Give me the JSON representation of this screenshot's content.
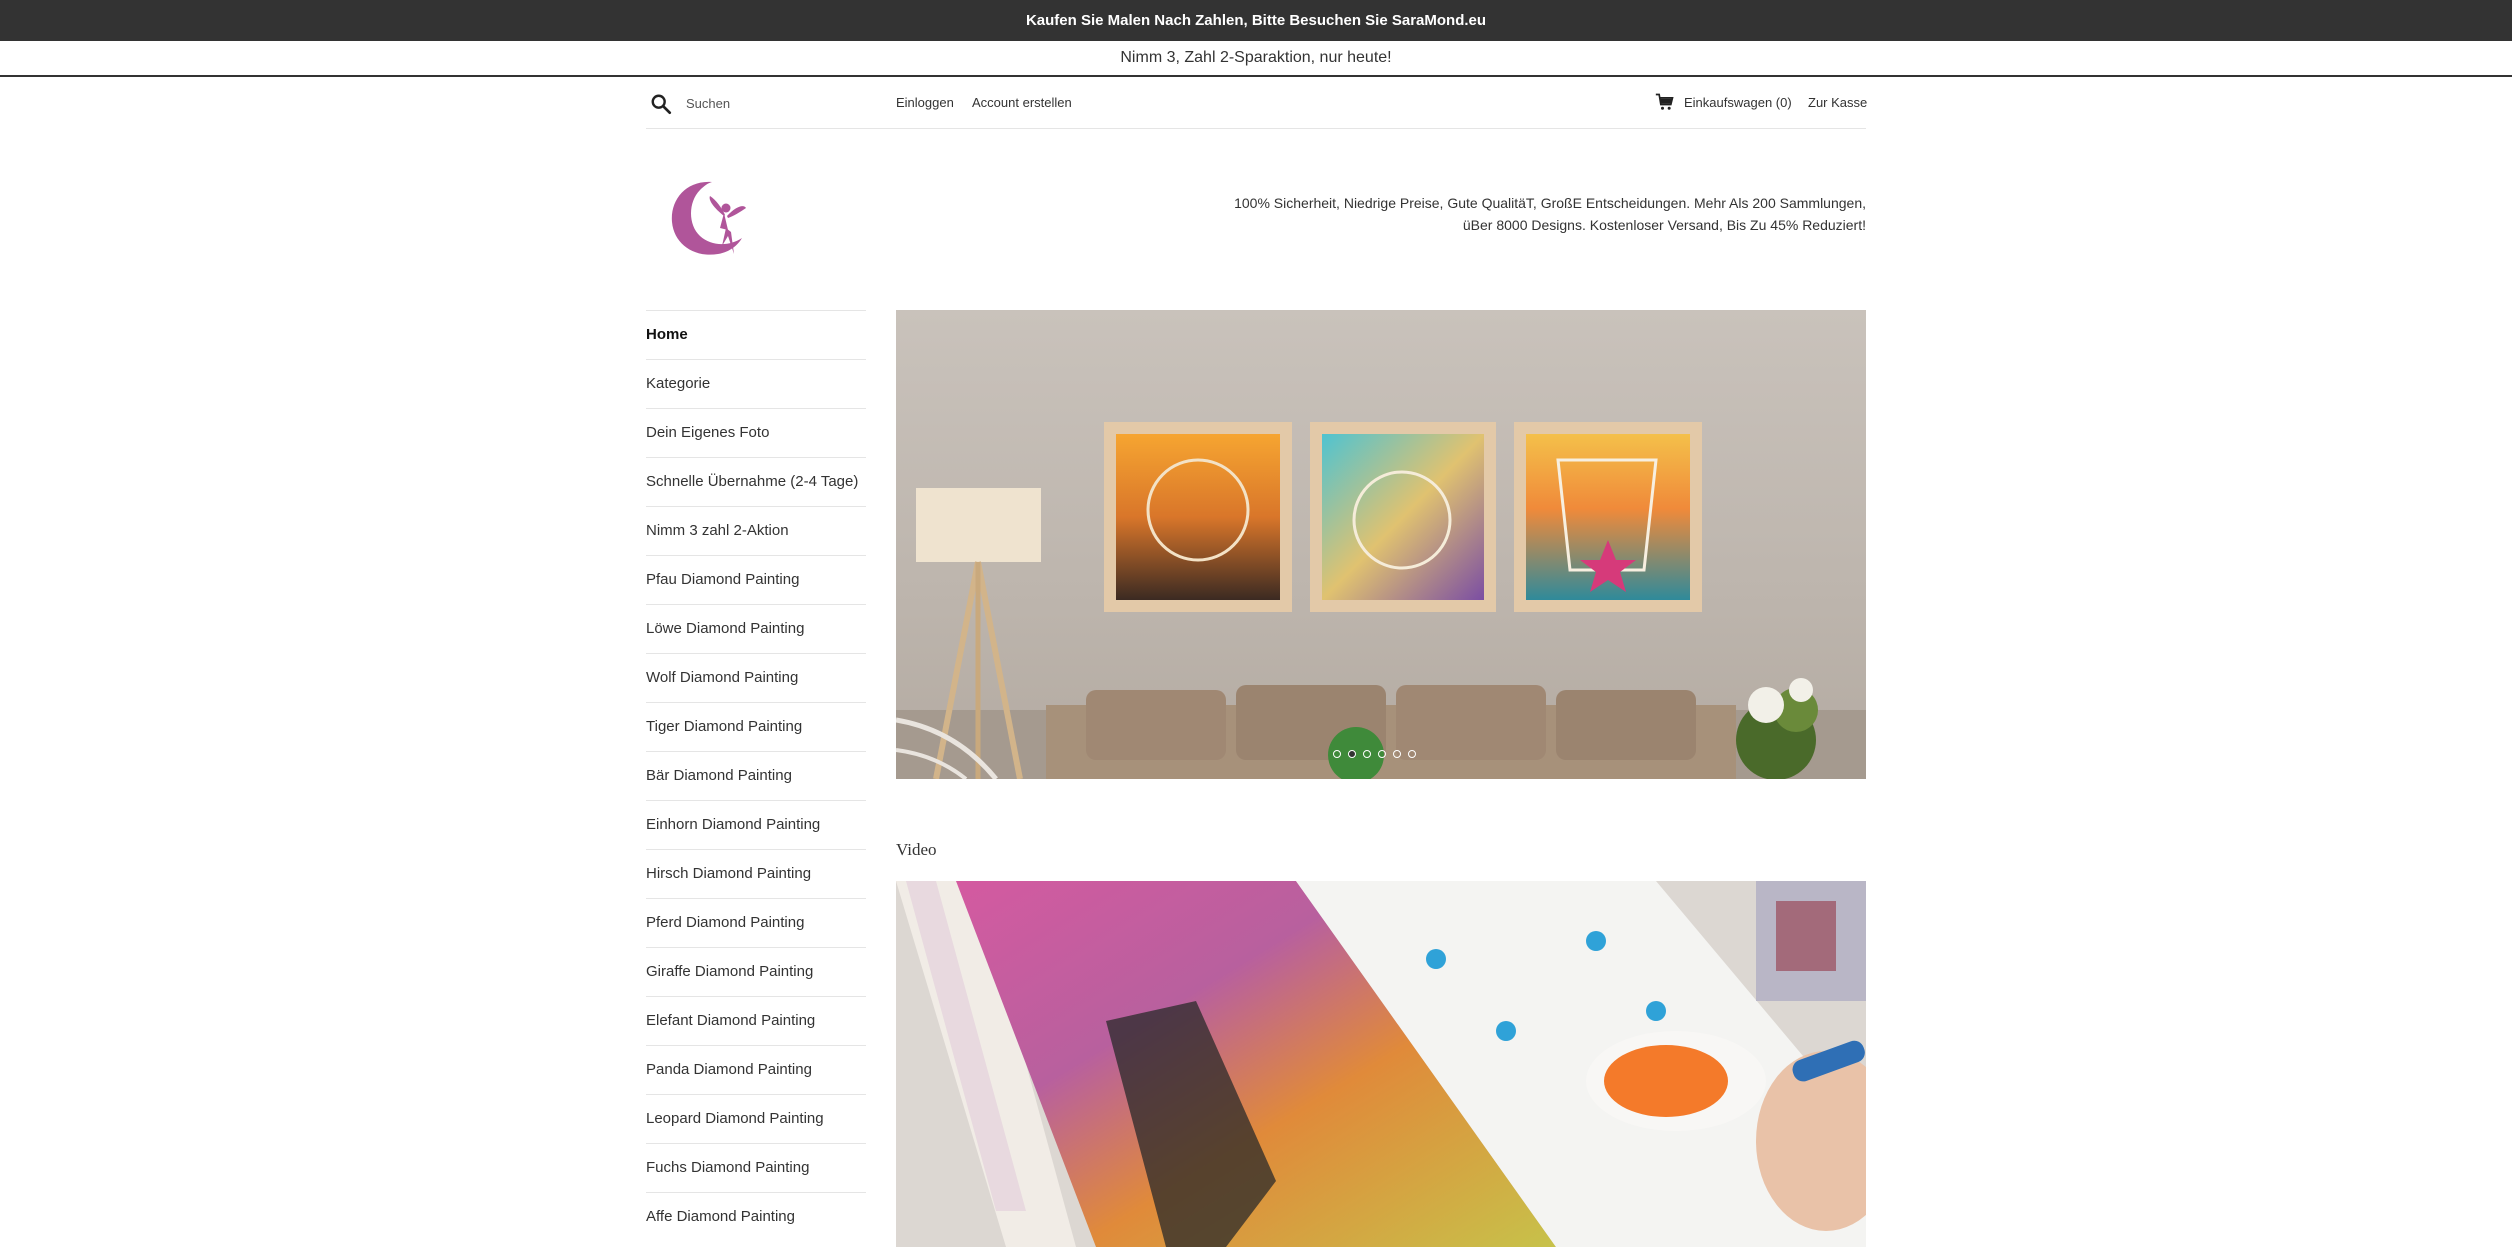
{
  "announcement": "Kaufen Sie Malen Nach Zahlen, Bitte Besuchen Sie SaraMond.eu",
  "promo": "Nimm 3, Zahl 2-Sparaktion, nur heute!",
  "header": {
    "search_placeholder": "Suchen",
    "login": "Einloggen",
    "create_account": "Account erstellen",
    "cart": "Einkaufswagen (0)",
    "checkout": "Zur Kasse"
  },
  "tagline": "100% Sicherheit, Niedrige Preise, Gute QualitäT, GroßE Entscheidungen. Mehr Als 200 Sammlungen, üBer 8000 Designs. Kostenloser Versand, Bis Zu 45% Reduziert!",
  "sidebar": {
    "items": [
      {
        "label": "Home"
      },
      {
        "label": "Kategorie"
      },
      {
        "label": "Dein Eigenes Foto"
      },
      {
        "label": "Schnelle Übernahme (2-4 Tage)"
      },
      {
        "label": "Nimm 3 zahl 2-Aktion"
      },
      {
        "label": "Pfau Diamond Painting"
      },
      {
        "label": "Löwe Diamond Painting"
      },
      {
        "label": "Wolf Diamond Painting"
      },
      {
        "label": "Tiger Diamond Painting"
      },
      {
        "label": "Bär Diamond Painting"
      },
      {
        "label": "Einhorn Diamond Painting"
      },
      {
        "label": "Hirsch Diamond Painting"
      },
      {
        "label": "Pferd Diamond Painting"
      },
      {
        "label": "Giraffe Diamond Painting"
      },
      {
        "label": "Elefant Diamond Painting"
      },
      {
        "label": "Panda Diamond Painting"
      },
      {
        "label": "Leopard Diamond Painting"
      },
      {
        "label": "Fuchs Diamond Painting"
      },
      {
        "label": "Affe Diamond Painting"
      }
    ]
  },
  "slideshow": {
    "slide_count": 6,
    "active_slide": 2
  },
  "video_section": {
    "title": "Video"
  },
  "colors": {
    "topbar": "#333333",
    "logo": "#b0559a",
    "text": "#333333"
  }
}
